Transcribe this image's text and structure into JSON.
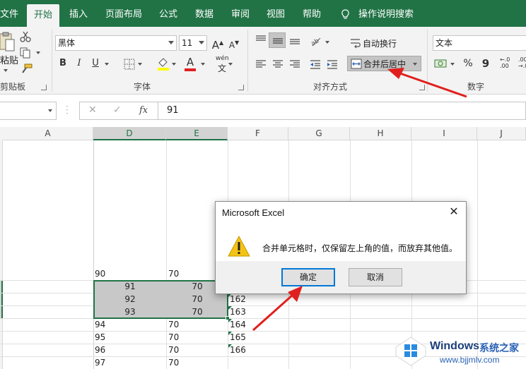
{
  "ribbon_tabs": [
    "文件",
    "开始",
    "插入",
    "页面布局",
    "公式",
    "数据",
    "审阅",
    "视图",
    "帮助",
    "操作说明搜索"
  ],
  "clipboard": {
    "paste_label": "粘贴",
    "group_label": "剪贴板"
  },
  "font": {
    "name": "黑体",
    "size": "11",
    "group_label": "字体",
    "grow_label": "A",
    "shrink_label": "A",
    "bold": "B",
    "italic": "I",
    "underline": "U",
    "color_a": "A",
    "phonetic": "wén"
  },
  "alignment": {
    "wrap_label": "自动换行",
    "merge_label": "合并后居中",
    "group_label": "对齐方式"
  },
  "number": {
    "format": "文本",
    "group_label": "数字",
    "percent": "%",
    "comma": "9",
    "inc_decimal": "←.0 .00",
    "dec_decimal": ".00 →.0"
  },
  "formula_bar": {
    "fx": "fx",
    "value": "91"
  },
  "columns": [
    "A",
    "D",
    "E",
    "F",
    "G",
    "H",
    "I",
    "J"
  ],
  "cells": {
    "d_plain_top": "90",
    "e_plain_top": "70",
    "d_sel": [
      "91",
      "92",
      "93"
    ],
    "e_sel": [
      "70",
      "70",
      "70"
    ],
    "d_plain": [
      "94",
      "95",
      "96",
      "97"
    ],
    "e_plain": [
      "70",
      "70",
      "70",
      "70"
    ],
    "f_values": [
      "162",
      "163",
      "164",
      "165",
      "166"
    ]
  },
  "dialog": {
    "title": "Microsoft Excel",
    "message": "合并单元格时，仅保留左上角的值，而放弃其他值。",
    "ok_label": "确定",
    "cancel_label": "取消",
    "close_glyph": "✕"
  },
  "watermark": {
    "line1": "Windows",
    "line2": "系统之家",
    "url": "www.bjjmlv.com"
  },
  "colors": {
    "excel_green": "#217346",
    "dialog_focus": "#0078d7",
    "warning_yellow": "#f3c316",
    "arrow_red": "#e0201e"
  }
}
